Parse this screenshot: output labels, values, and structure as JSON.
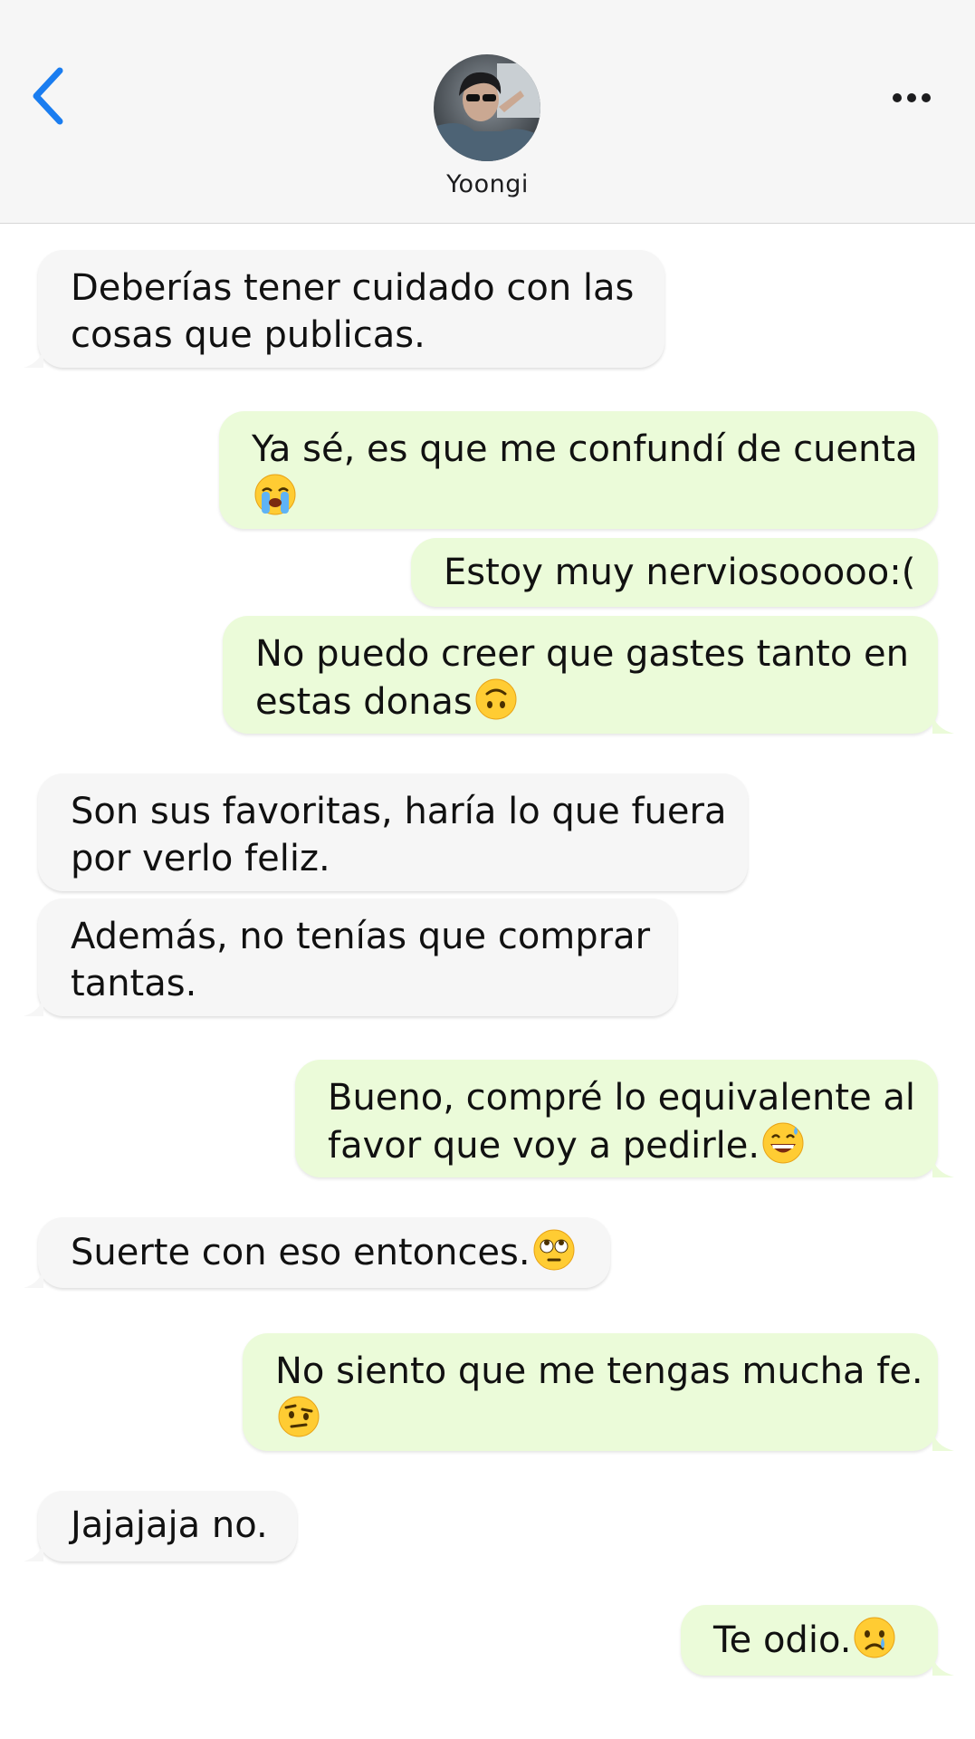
{
  "header": {
    "contact_name": "Yoongi",
    "accent_color": "#1a7df0",
    "back_icon": "chevron-left-icon",
    "more_icon": "ellipsis-icon"
  },
  "colors": {
    "incoming_bubble": "#f6f6f6",
    "outgoing_bubble": "#ebfbd9"
  },
  "messages": [
    {
      "direction": "incoming",
      "lines": [
        "Deberías tener cuidado con las",
        "cosas que publicas."
      ]
    },
    {
      "direction": "outgoing",
      "lines": [
        "Ya sé, es que me confundí de cuenta"
      ],
      "emoji": "loudly-crying-face-emoji"
    },
    {
      "direction": "outgoing",
      "lines": [
        "Estoy muy nerviosooooo:("
      ]
    },
    {
      "direction": "outgoing",
      "lines": [
        "No puedo creer que gastes tanto en",
        "estas donas"
      ],
      "emoji": "upside-down-face-emoji"
    },
    {
      "direction": "incoming",
      "lines": [
        "Son sus favoritas, haría lo que fuera",
        "por verlo feliz."
      ]
    },
    {
      "direction": "incoming",
      "lines": [
        "Además, no tenías que comprar",
        "tantas."
      ]
    },
    {
      "direction": "outgoing",
      "lines": [
        "Bueno, compré lo equivalente al",
        "favor que voy a pedirle."
      ],
      "emoji": "grinning-sweat-face-emoji"
    },
    {
      "direction": "incoming",
      "lines": [
        "Suerte con eso entonces."
      ],
      "emoji": "eye-roll-face-emoji"
    },
    {
      "direction": "outgoing",
      "lines": [
        "No siento que me tengas mucha fe."
      ],
      "emoji": "raised-eyebrow-face-emoji"
    },
    {
      "direction": "incoming",
      "lines": [
        "Jajajaja no."
      ]
    },
    {
      "direction": "outgoing",
      "lines": [
        "Te odio."
      ],
      "emoji": "crying-face-emoji"
    }
  ]
}
